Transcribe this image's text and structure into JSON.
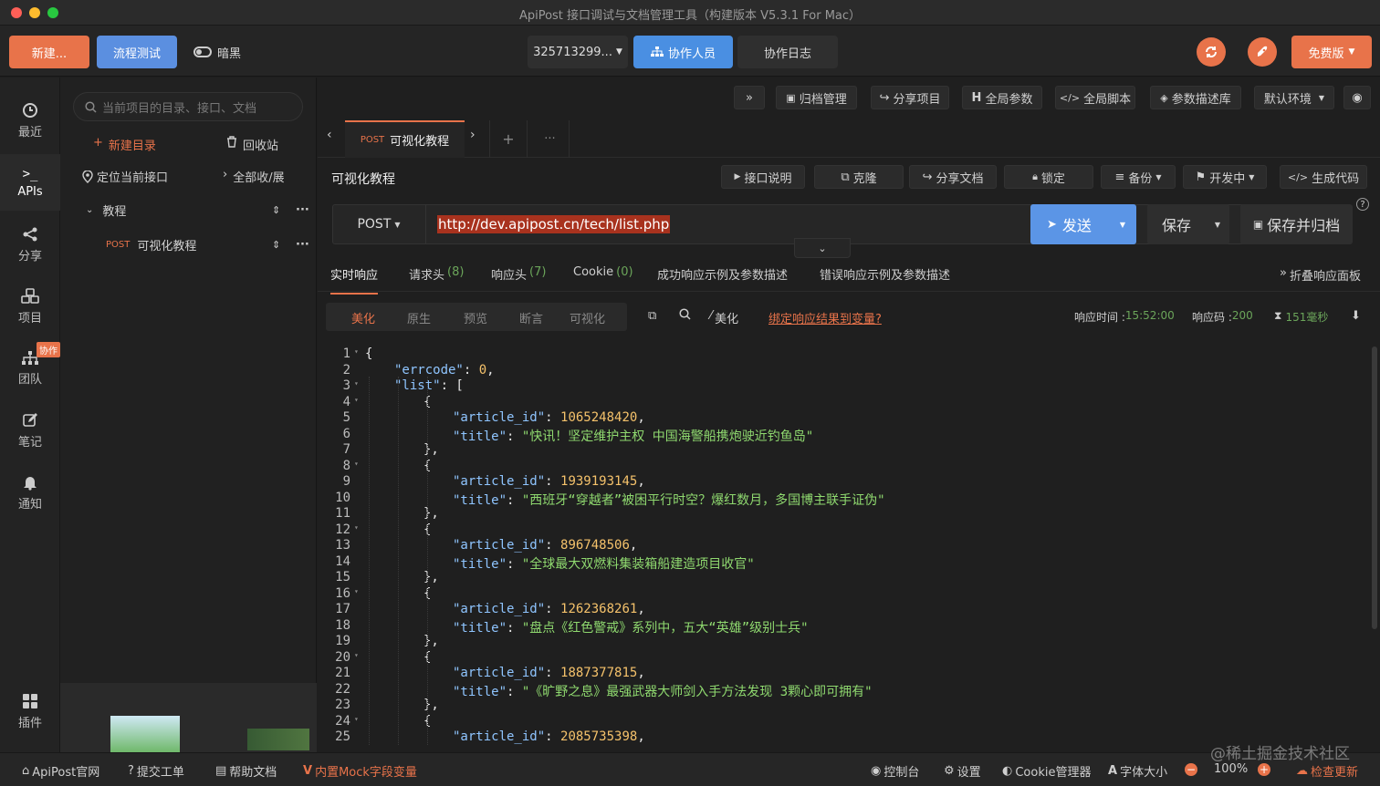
{
  "window": {
    "title": "ApiPost 接口调试与文档管理工具（构建版本 V5.3.1 For Mac）"
  },
  "toolbar": {
    "new_label": "新建...",
    "flow_test_label": "流程测试",
    "dark_label": "暗黑",
    "project_id": "325713299...",
    "collaborators_label": "协作人员",
    "collab_log_label": "协作日志",
    "free_label": "免费版"
  },
  "nav": [
    {
      "label": "最近",
      "icon": "clock-icon"
    },
    {
      "label": "APIs",
      "icon": "terminal-icon"
    },
    {
      "label": "分享",
      "icon": "share-icon"
    },
    {
      "label": "项目",
      "icon": "cubes-icon"
    },
    {
      "label": "团队",
      "icon": "sitemap-icon",
      "badge": "协作"
    },
    {
      "label": "笔记",
      "icon": "edit-icon"
    },
    {
      "label": "通知",
      "icon": "bell-icon"
    },
    {
      "label": "插件",
      "icon": "grid-icon"
    }
  ],
  "tree": {
    "search_placeholder": "当前项目的目录、接口、文档",
    "new_folder": "新建目录",
    "recycle": "回收站",
    "locate": "定位当前接口",
    "collapse_all": "全部收/展",
    "folder": "教程",
    "item_method": "POST",
    "item_name": "可视化教程"
  },
  "main_toolbar": [
    "»",
    "归档管理",
    "分享项目",
    "全局参数",
    "全局脚本",
    "参数描述库",
    "默认环境"
  ],
  "tabs": {
    "method": "POST",
    "name": "可视化教程",
    "add": "+",
    "more": "···"
  },
  "request": {
    "title": "可视化教程",
    "actions": [
      "接口说明",
      "克隆",
      "分享文档",
      "锁定",
      "备份",
      "开发中",
      "生成代码"
    ],
    "method": "POST",
    "url": "http://dev.apipost.cn/tech/list.php",
    "send": "发送",
    "save": "保存",
    "save_archive": "保存并归档"
  },
  "resp_tabs": [
    {
      "label": "实时响应",
      "count": ""
    },
    {
      "label": "请求头",
      "count": "(8)"
    },
    {
      "label": "响应头",
      "count": "(7)"
    },
    {
      "label": "Cookie",
      "count": "(0)"
    },
    {
      "label": "成功响应示例及参数描述",
      "count": ""
    },
    {
      "label": "错误响应示例及参数描述",
      "count": ""
    }
  ],
  "fold_panel": "折叠响应面板",
  "view_modes": [
    "美化",
    "原生",
    "预览",
    "断言",
    "可视化"
  ],
  "resp_tools": {
    "beautify": "美化",
    "bind_link": "绑定响应结果到变量?"
  },
  "resp_meta": {
    "time_label": "响应时间 : ",
    "time": "15:52:00",
    "code_label": "响应码 : ",
    "code": "200",
    "duration": "151毫秒"
  },
  "code_lines": [
    {
      "n": "1",
      "indent": 0,
      "parts": [
        [
          "p",
          "{"
        ]
      ]
    },
    {
      "n": "2",
      "indent": 1,
      "parts": [
        [
          "k",
          "\"errcode\""
        ],
        [
          "p",
          ": "
        ],
        [
          "n",
          "0"
        ],
        [
          "p",
          ","
        ]
      ]
    },
    {
      "n": "3",
      "indent": 1,
      "parts": [
        [
          "k",
          "\"list\""
        ],
        [
          "p",
          ": ["
        ]
      ]
    },
    {
      "n": "4",
      "indent": 2,
      "parts": [
        [
          "p",
          "{"
        ]
      ]
    },
    {
      "n": "5",
      "indent": 3,
      "parts": [
        [
          "k",
          "\"article_id\""
        ],
        [
          "p",
          ": "
        ],
        [
          "n",
          "1065248420"
        ],
        [
          "p",
          ","
        ]
      ]
    },
    {
      "n": "6",
      "indent": 3,
      "parts": [
        [
          "k",
          "\"title\""
        ],
        [
          "p",
          ": "
        ],
        [
          "s",
          "\"快讯！坚定维护主权 中国海警船携炮驶近钓鱼岛\""
        ]
      ]
    },
    {
      "n": "7",
      "indent": 2,
      "parts": [
        [
          "p",
          "},"
        ]
      ]
    },
    {
      "n": "8",
      "indent": 2,
      "parts": [
        [
          "p",
          "{"
        ]
      ]
    },
    {
      "n": "9",
      "indent": 3,
      "parts": [
        [
          "k",
          "\"article_id\""
        ],
        [
          "p",
          ": "
        ],
        [
          "n",
          "1939193145"
        ],
        [
          "p",
          ","
        ]
      ]
    },
    {
      "n": "10",
      "indent": 3,
      "parts": [
        [
          "k",
          "\"title\""
        ],
        [
          "p",
          ": "
        ],
        [
          "s",
          "\"西班牙“穿越者”被困平行时空？爆红数月，多国博主联手证伪\""
        ]
      ]
    },
    {
      "n": "11",
      "indent": 2,
      "parts": [
        [
          "p",
          "},"
        ]
      ]
    },
    {
      "n": "12",
      "indent": 2,
      "parts": [
        [
          "p",
          "{"
        ]
      ]
    },
    {
      "n": "13",
      "indent": 3,
      "parts": [
        [
          "k",
          "\"article_id\""
        ],
        [
          "p",
          ": "
        ],
        [
          "n",
          "896748506"
        ],
        [
          "p",
          ","
        ]
      ]
    },
    {
      "n": "14",
      "indent": 3,
      "parts": [
        [
          "k",
          "\"title\""
        ],
        [
          "p",
          ": "
        ],
        [
          "s",
          "\"全球最大双燃料集装箱船建造项目收官\""
        ]
      ]
    },
    {
      "n": "15",
      "indent": 2,
      "parts": [
        [
          "p",
          "},"
        ]
      ]
    },
    {
      "n": "16",
      "indent": 2,
      "parts": [
        [
          "p",
          "{"
        ]
      ]
    },
    {
      "n": "17",
      "indent": 3,
      "parts": [
        [
          "k",
          "\"article_id\""
        ],
        [
          "p",
          ": "
        ],
        [
          "n",
          "1262368261"
        ],
        [
          "p",
          ","
        ]
      ]
    },
    {
      "n": "18",
      "indent": 3,
      "parts": [
        [
          "k",
          "\"title\""
        ],
        [
          "p",
          ": "
        ],
        [
          "s",
          "\"盘点《红色警戒》系列中，五大“英雄”级别士兵\""
        ]
      ]
    },
    {
      "n": "19",
      "indent": 2,
      "parts": [
        [
          "p",
          "},"
        ]
      ]
    },
    {
      "n": "20",
      "indent": 2,
      "parts": [
        [
          "p",
          "{"
        ]
      ]
    },
    {
      "n": "21",
      "indent": 3,
      "parts": [
        [
          "k",
          "\"article_id\""
        ],
        [
          "p",
          ": "
        ],
        [
          "n",
          "1887377815"
        ],
        [
          "p",
          ","
        ]
      ]
    },
    {
      "n": "22",
      "indent": 3,
      "parts": [
        [
          "k",
          "\"title\""
        ],
        [
          "p",
          ": "
        ],
        [
          "s",
          "\"《旷野之息》最强武器大师剑入手方法发现 3颗心即可拥有\""
        ]
      ]
    },
    {
      "n": "23",
      "indent": 2,
      "parts": [
        [
          "p",
          "},"
        ]
      ]
    },
    {
      "n": "24",
      "indent": 2,
      "parts": [
        [
          "p",
          "{"
        ]
      ]
    },
    {
      "n": "25",
      "indent": 3,
      "parts": [
        [
          "k",
          "\"article_id\""
        ],
        [
          "p",
          ": "
        ],
        [
          "n",
          "2085735398"
        ],
        [
          "p",
          ","
        ]
      ]
    }
  ],
  "status_bar": {
    "official": "ApiPost官网",
    "ticket": "提交工单",
    "help": "帮助文档",
    "mock": "内置Mock字段变量",
    "console": "控制台",
    "settings": "设置",
    "cookie": "Cookie管理器",
    "font_size": "字体大小",
    "zoom": "100%",
    "update": "检查更新",
    "watermark": "@稀土掘金技术社区"
  },
  "colors": {
    "accent": "#e8734a",
    "blue": "#4a90e2",
    "green": "#6ba55a"
  }
}
